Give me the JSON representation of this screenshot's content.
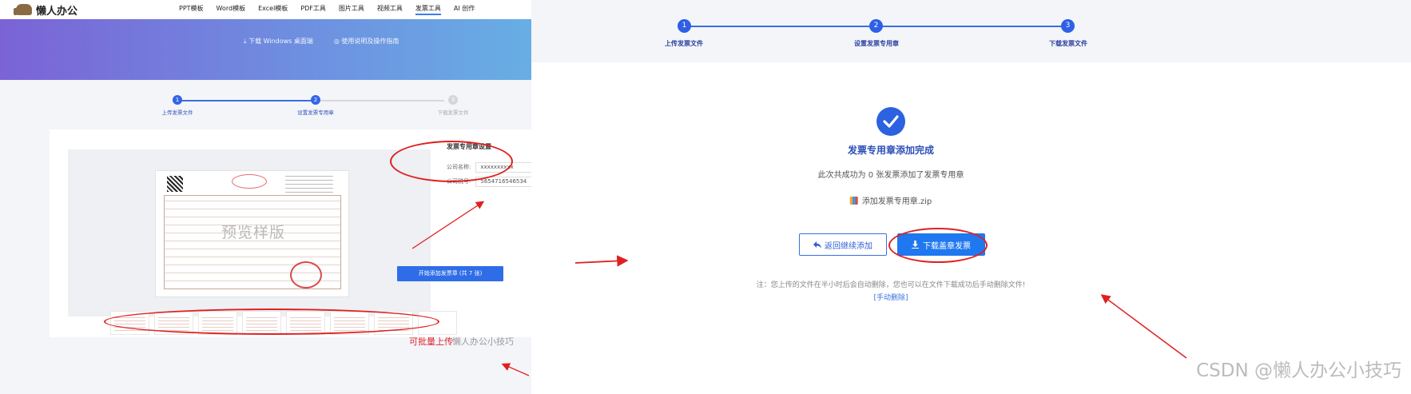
{
  "left": {
    "logo_text": "懒人办公",
    "nav": [
      "PPT模板",
      "Word模板",
      "Excel模板",
      "PDF工具",
      "图片工具",
      "视频工具",
      "发票工具",
      "AI 创作"
    ],
    "nav_active_index": 6,
    "banner_links": [
      "⤓ 下载 Windows 桌面端",
      "◎ 使用说明及操作指南"
    ],
    "steps": [
      {
        "num": "1",
        "label": "上传发票文件",
        "state": "done"
      },
      {
        "num": "2",
        "label": "设置发票专用章",
        "state": "active"
      },
      {
        "num": "3",
        "label": "下载发票文件",
        "state": "pending"
      }
    ],
    "preview_watermark": "预览样版",
    "settings": {
      "title": "发票专用章设置",
      "company_label": "公司名称:",
      "company_value": "xxxxxxxxxx",
      "tax_label": "公司税号:",
      "tax_value": "5654716546534"
    },
    "start_button": "开始添加发票章 (共 7 张)",
    "thumbnail_count": 8,
    "batch_note": "可批量上传",
    "watermark": "懒人办公小技巧"
  },
  "right": {
    "steps": [
      {
        "num": "1",
        "label": "上传发票文件"
      },
      {
        "num": "2",
        "label": "设置发票专用章"
      },
      {
        "num": "3",
        "label": "下载发票文件"
      }
    ],
    "done_title": "发票专用章添加完成",
    "done_desc": "此次共成功为 0 张发票添加了发票专用章",
    "zip_file": "添加发票专用章.zip",
    "back_button": "返回继续添加",
    "download_button": "下载盖章发票",
    "note": "注：您上传的文件在半小时后会自动删除，您也可以在文件下载成功后手动删除文件!",
    "manual_delete": "[手动删除]",
    "csdn_watermark": "CSDN @懒人办公小技巧"
  },
  "colors": {
    "accent": "#2f6de8",
    "annotation_red": "#e02020",
    "banner_start": "#7b63d6",
    "banner_end": "#66b6e6"
  }
}
